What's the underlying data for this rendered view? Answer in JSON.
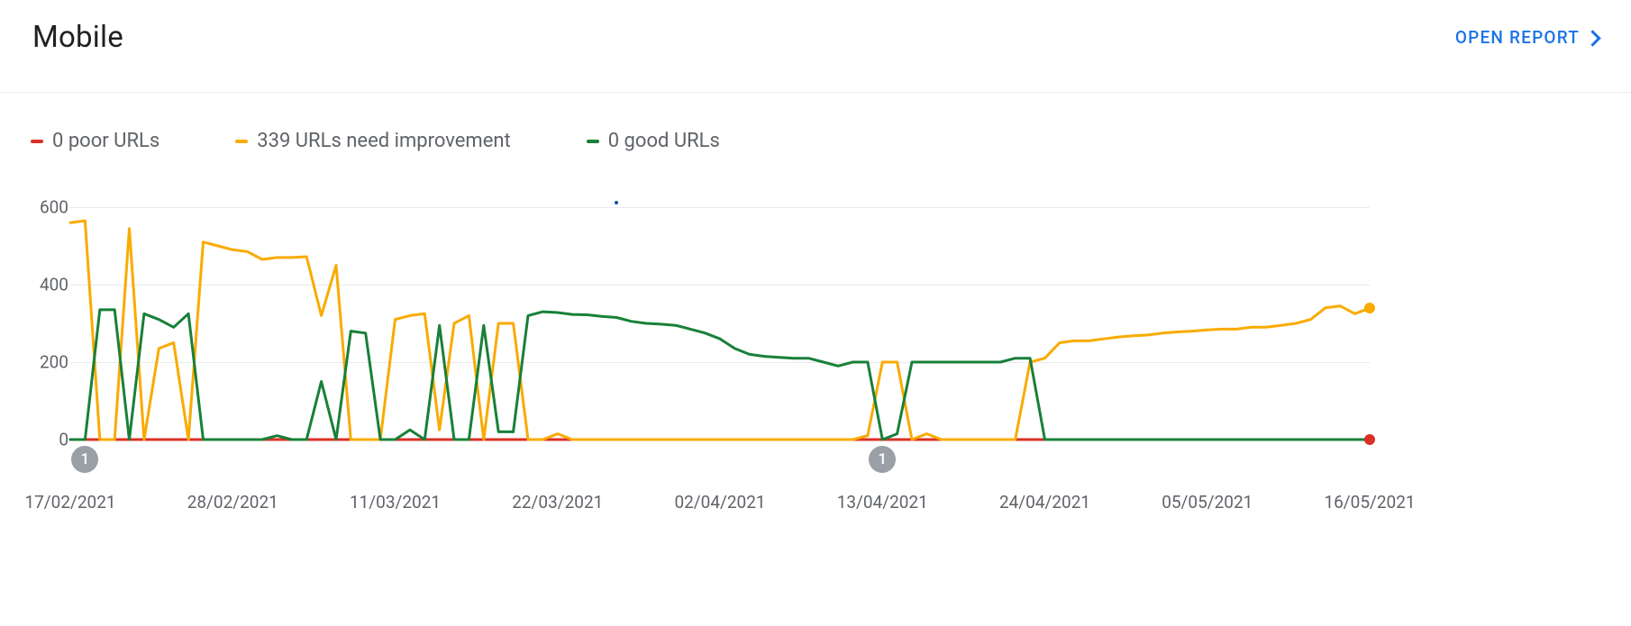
{
  "header": {
    "title": "Mobile",
    "open_report_label": "OPEN REPORT"
  },
  "colors": {
    "poor": "#d93025",
    "needs": "#f9ab00",
    "good": "#188038",
    "link": "#1a73e8",
    "marker": "#9aa0a6"
  },
  "legend": {
    "poor_label": "0 poor URLs",
    "needs_label": "339 URLs need improvement",
    "good_label": "0 good URLs"
  },
  "y_ticks": [
    "0",
    "200",
    "400",
    "600"
  ],
  "x_ticks": [
    "17/02/2021",
    "28/02/2021",
    "11/03/2021",
    "22/03/2021",
    "02/04/2021",
    "13/04/2021",
    "24/04/2021",
    "05/05/2021",
    "16/05/2021"
  ],
  "marker1_label": "1",
  "marker2_label": "1",
  "chart_data": {
    "type": "line",
    "title": "Mobile",
    "xlabel": "",
    "ylabel": "",
    "ylim": [
      0,
      600
    ],
    "x_tick_labels": [
      "17/02/2021",
      "28/02/2021",
      "11/03/2021",
      "22/03/2021",
      "02/04/2021",
      "13/04/2021",
      "24/04/2021",
      "05/05/2021",
      "16/05/2021"
    ],
    "x": [
      0,
      1,
      2,
      3,
      4,
      5,
      6,
      7,
      8,
      9,
      10,
      11,
      12,
      13,
      14,
      15,
      16,
      17,
      18,
      19,
      20,
      21,
      22,
      23,
      24,
      25,
      26,
      27,
      28,
      29,
      30,
      31,
      32,
      33,
      34,
      35,
      36,
      37,
      38,
      39,
      40,
      41,
      42,
      43,
      44,
      45,
      46,
      47,
      48,
      49,
      50,
      51,
      52,
      53,
      54,
      55,
      56,
      57,
      58,
      59,
      60,
      61,
      62,
      63,
      64,
      65,
      66,
      67,
      68,
      69,
      70,
      71,
      72,
      73,
      74,
      75,
      76,
      77,
      78,
      79,
      80,
      81,
      82,
      83,
      84,
      85,
      86,
      87,
      88
    ],
    "series": [
      {
        "name": "0 poor URLs",
        "color": "#d93025",
        "values": [
          0,
          0,
          0,
          0,
          0,
          0,
          0,
          0,
          0,
          0,
          0,
          0,
          0,
          0,
          0,
          0,
          0,
          0,
          0,
          0,
          0,
          0,
          0,
          0,
          0,
          0,
          0,
          0,
          0,
          0,
          0,
          0,
          0,
          0,
          0,
          0,
          0,
          0,
          0,
          0,
          0,
          0,
          0,
          0,
          0,
          0,
          0,
          0,
          0,
          0,
          0,
          0,
          0,
          0,
          0,
          0,
          0,
          0,
          0,
          0,
          0,
          0,
          0,
          0,
          0,
          0,
          0,
          0,
          0,
          0,
          0,
          0,
          0,
          0,
          0,
          0,
          0,
          0,
          0,
          0,
          0,
          0,
          0,
          0,
          0,
          0,
          0,
          0,
          0
        ]
      },
      {
        "name": "339 URLs need improvement",
        "color": "#f9ab00",
        "values": [
          560,
          565,
          0,
          0,
          545,
          0,
          235,
          250,
          0,
          510,
          500,
          490,
          485,
          465,
          470,
          470,
          472,
          320,
          450,
          0,
          0,
          0,
          310,
          320,
          325,
          25,
          300,
          320,
          0,
          300,
          300,
          0,
          0,
          15,
          0,
          0,
          0,
          0,
          0,
          0,
          0,
          0,
          0,
          0,
          0,
          0,
          0,
          0,
          0,
          0,
          0,
          0,
          0,
          0,
          10,
          200,
          200,
          0,
          15,
          0,
          0,
          0,
          0,
          0,
          0,
          200,
          210,
          250,
          255,
          255,
          260,
          265,
          268,
          270,
          275,
          278,
          280,
          283,
          285,
          285,
          290,
          290,
          295,
          300,
          310,
          340,
          345,
          325,
          339
        ]
      },
      {
        "name": "0 good URLs",
        "color": "#188038",
        "values": [
          0,
          0,
          335,
          335,
          0,
          325,
          310,
          290,
          325,
          0,
          0,
          0,
          0,
          0,
          10,
          0,
          0,
          150,
          0,
          280,
          275,
          0,
          0,
          25,
          0,
          295,
          0,
          0,
          295,
          20,
          20,
          320,
          330,
          328,
          323,
          322,
          318,
          315,
          305,
          300,
          298,
          295,
          285,
          275,
          260,
          235,
          220,
          215,
          212,
          210,
          210,
          200,
          190,
          200,
          200,
          0,
          15,
          200,
          200,
          200,
          200,
          200,
          200,
          200,
          210,
          210,
          0,
          0,
          0,
          0,
          0,
          0,
          0,
          0,
          0,
          0,
          0,
          0,
          0,
          0,
          0,
          0,
          0,
          0,
          0,
          0,
          0,
          0,
          0
        ]
      }
    ],
    "legend_position": "top-left",
    "grid": true,
    "annotations": [
      {
        "type": "marker",
        "x": 1,
        "label": "1"
      },
      {
        "type": "marker",
        "x": 55,
        "label": "1"
      }
    ]
  }
}
